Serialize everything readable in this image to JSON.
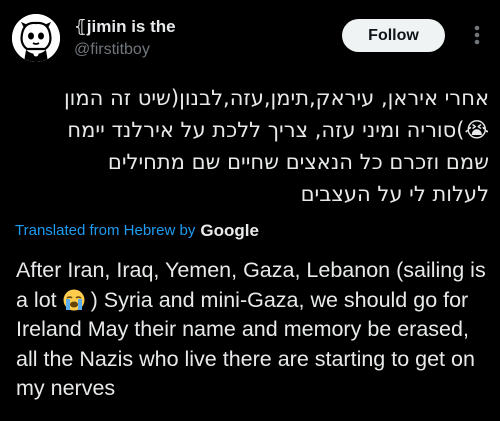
{
  "author": {
    "display_name": "⦃jimin is the",
    "handle": "@firstitboy",
    "avatar_icon": "cartoon-avatar-icon"
  },
  "actions": {
    "follow_label": "Follow",
    "more_icon": "vertical-ellipsis-icon"
  },
  "post": {
    "hebrew_lines": [
      "אחרי איראן, עיראק,תימן,עזה,לבנון(שיט זה המון",
      "😭)סוריה ומיני עזה, צריך ללכת על אירלנד יימח",
      "שמם וזכרם כל הנאצים שחיים שם מתחילים",
      "לעלות לי על העצבים"
    ],
    "translated_label": "Translated from Hebrew by",
    "translator": "Google",
    "english_before_emoji": "After Iran, Iraq, Yemen, Gaza, Lebanon (sailing is a lot ",
    "emoji_name": "loudly-crying-face-icon",
    "english_after_emoji": " ) Syria and mini-Gaza, we should go for Ireland May their name and memory be erased, all the Nazis who live there are starting to get on my nerves"
  },
  "colors": {
    "background": "#000000",
    "text": "#e7e9ea",
    "secondary": "#71767b",
    "link": "#1d9bf0",
    "button_bg": "#eff3f4"
  }
}
